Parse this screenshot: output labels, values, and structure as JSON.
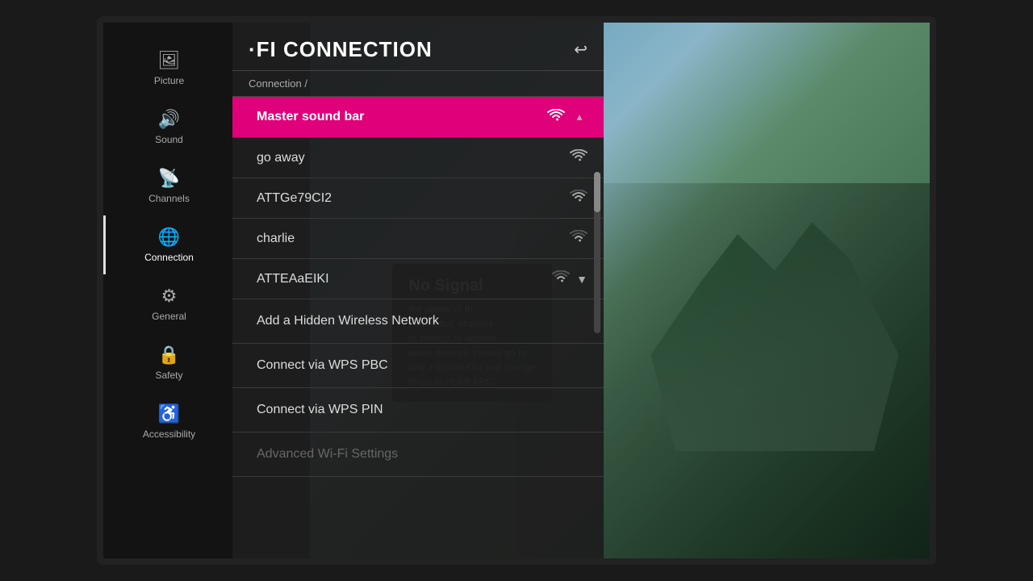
{
  "tv": {
    "title": "Wi-Fi Connection",
    "title_partial": "·FI CONNECTION",
    "breadcrumb": "Connection /",
    "back_button": "↩"
  },
  "sidebar": {
    "items": [
      {
        "id": "picture",
        "label": "Picture",
        "icon": "🖼",
        "active": false
      },
      {
        "id": "sound",
        "label": "Sound",
        "icon": "🔊",
        "active": false
      },
      {
        "id": "channels",
        "label": "Channels",
        "icon": "📡",
        "active": false
      },
      {
        "id": "connection",
        "label": "Connection",
        "icon": "🌐",
        "active": true
      },
      {
        "id": "general",
        "label": "General",
        "icon": "⚙",
        "active": false
      },
      {
        "id": "safety",
        "label": "Safety",
        "icon": "🔒",
        "active": false
      },
      {
        "id": "accessibility",
        "label": "Accessibility",
        "icon": "♿",
        "active": false
      }
    ]
  },
  "networks": {
    "list": [
      {
        "id": "master-sound-bar",
        "name": "Master sound bar",
        "selected": true,
        "signal": "strong",
        "has_dropdown": false,
        "scroll_up": true
      },
      {
        "id": "go-away",
        "name": "go away",
        "selected": false,
        "signal": "strong",
        "has_dropdown": false
      },
      {
        "id": "attge79ci2",
        "name": "ATTGe79CI2",
        "selected": false,
        "signal": "medium",
        "has_dropdown": false
      },
      {
        "id": "charlie",
        "name": "charlie",
        "selected": false,
        "signal": "weak",
        "has_dropdown": false
      },
      {
        "id": "atteaaeiki",
        "name": "ATTEAaEIKI",
        "selected": false,
        "signal": "weak",
        "has_dropdown": true
      }
    ]
  },
  "actions": [
    {
      "id": "add-hidden",
      "label": "Add a Hidden Wireless Network",
      "disabled": false
    },
    {
      "id": "connect-wps-pbc",
      "label": "Connect via WPS PBC",
      "disabled": false
    },
    {
      "id": "connect-wps-pin",
      "label": "Connect via WPS PIN",
      "disabled": false
    },
    {
      "id": "advanced-wifi",
      "label": "Advanced Wi-Fi Settings",
      "disabled": true
    }
  ],
  "no_signal": {
    "title": "No Signal",
    "lines": [
      "the power of th",
      "tion status, or press",
      "to change to another",
      "audio devices, please go to",
      "und > Sound Out and change",
      "ttings to HDMI ARC."
    ]
  },
  "colors": {
    "accent": "#e0007a",
    "sidebar_bg": "#141414",
    "panel_bg": "#1e1e1e",
    "selected_bg": "#e0007a"
  }
}
